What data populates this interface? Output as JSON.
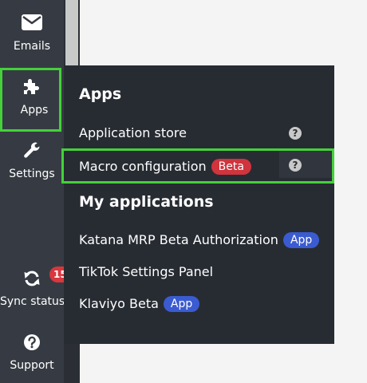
{
  "sidebar": {
    "items": [
      {
        "label": "Emails",
        "icon": "envelope-icon"
      },
      {
        "label": "Apps",
        "icon": "puzzle-icon"
      },
      {
        "label": "Settings",
        "icon": "wrench-icon"
      },
      {
        "label": "Sync status",
        "icon": "sync-icon",
        "badge": "15"
      },
      {
        "label": "Support",
        "icon": "question-circle-icon"
      }
    ]
  },
  "menu": {
    "apps_title": "Apps",
    "application_store": "Application store",
    "macro_configuration": "Macro configuration",
    "beta_badge": "Beta",
    "my_applications_title": "My applications",
    "applications": [
      {
        "name": "Katana MRP Beta Authorization",
        "badge": "App"
      },
      {
        "name": "TikTok Settings Panel",
        "badge": ""
      },
      {
        "name": "Klaviyo Beta",
        "badge": "App"
      }
    ],
    "help_glyph": "?"
  },
  "colors": {
    "sidebar_bg": "#363b43",
    "dropdown_bg": "#272c33",
    "highlight_border": "#44d13a",
    "beta_badge": "#d0343d",
    "app_badge": "#3b5bd1",
    "count_badge": "#d9363e"
  }
}
